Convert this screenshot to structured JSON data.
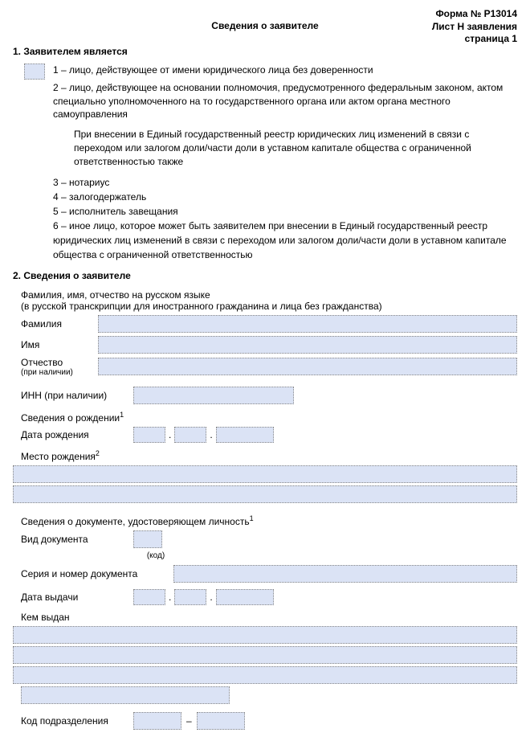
{
  "header": {
    "form_number": "Форма № Р13014",
    "sheet": "Лист Н заявления",
    "page": "страница 1"
  },
  "title": "Сведения о заявителе",
  "section1": {
    "heading": "1. Заявителем является",
    "opt1": "1 – лицо, действующее от имени юридического лица без доверенности",
    "opt2": "2 – лицо, действующее на основании полномочия, предусмотренного федеральным законом, актом специально уполномоченного на то государственного органа или актом органа местного самоуправления",
    "note": "При внесении в Единый государственный реестр юридических лиц изменений в связи с переходом или залогом доли/части доли в уставном капитале общества с ограниченной ответственностью также",
    "item3": "3 – нотариус",
    "item4": "4 – залогодержатель",
    "item5": "5 – исполнитель завещания",
    "item6": "6 – иное лицо, которое может быть заявителем при внесении в Единый государственный реестр юридических лиц изменений в связи с переходом или залогом доли/части доли в уставном капитале общества с ограниченной ответственностью"
  },
  "section2": {
    "heading": "2. Сведения о заявителе",
    "name_intro": "Фамилия, имя, отчество на русском языке",
    "name_sub": "(в русской транскрипции для иностранного гражданина и лица без гражданства)",
    "surname": "Фамилия",
    "firstname": "Имя",
    "patronymic": "Отчество",
    "patronymic_hint": "(при наличии)",
    "inn": "ИНН (при наличии)",
    "birth_heading": "Сведения о рождении",
    "birth_date": "Дата рождения",
    "birth_place": "Место рождения",
    "doc_heading": "Сведения о документе, удостоверяющем личность",
    "doc_type": "Вид документа",
    "code_hint": "(код)",
    "doc_serial": "Серия и номер документа",
    "issue_date": "Дата выдачи",
    "issued_by": "Кем выдан",
    "dept_code": "Код подразделения"
  }
}
